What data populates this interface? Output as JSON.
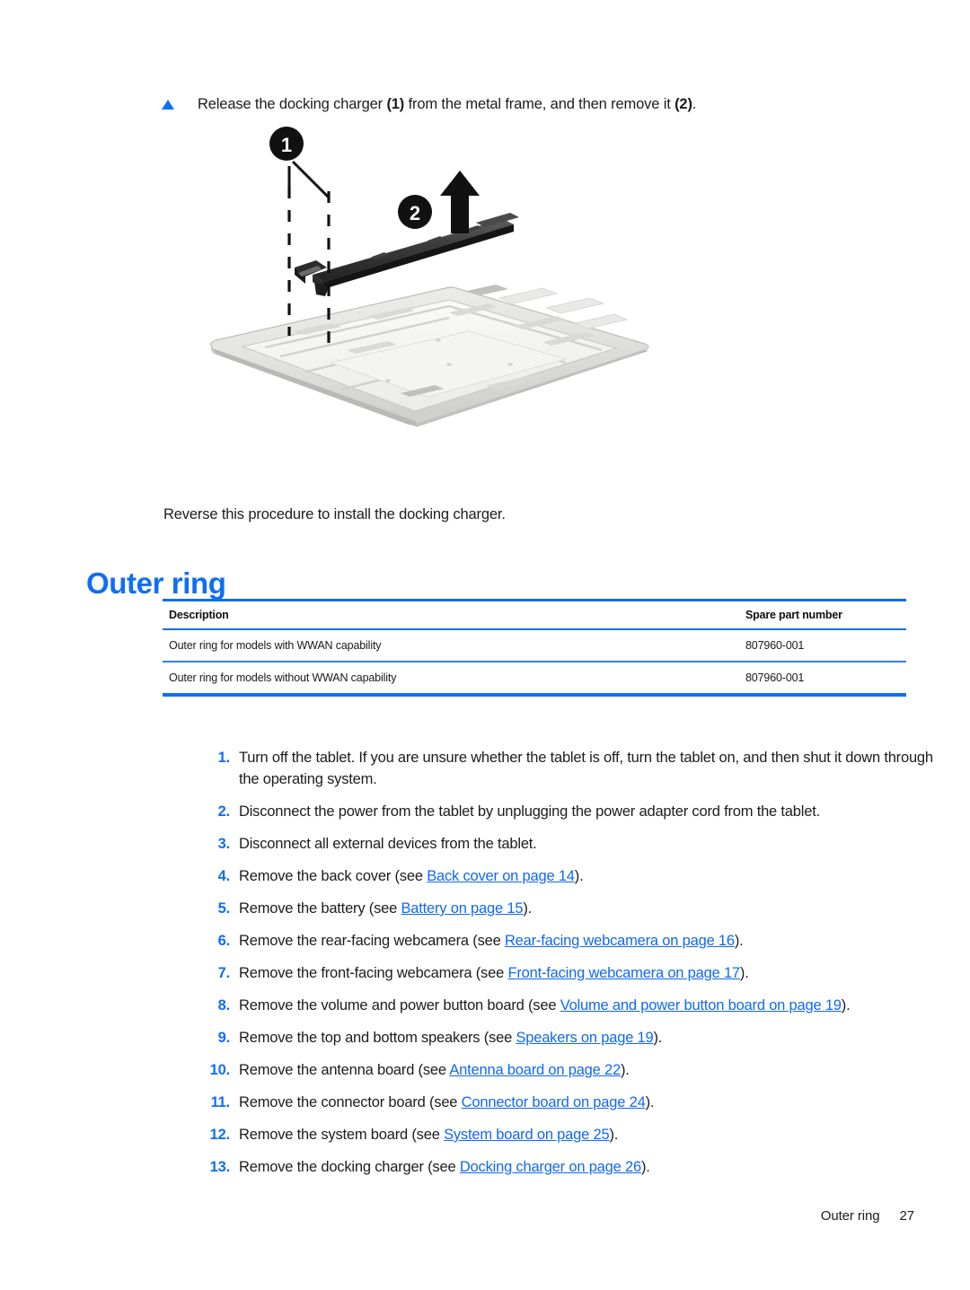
{
  "document": {
    "intro_step": {
      "bullet_icon": "triangle-bullet-icon",
      "text_before": "Release the docking charger ",
      "callout_1": "(1)",
      "text_middle": " from the metal frame, and then remove it ",
      "callout_2": "(2)",
      "text_after": "."
    },
    "figure": {
      "alt": "Exploded view of docking charger removal from tablet metal frame",
      "callouts": [
        {
          "label": "1",
          "meaning": "release-points"
        },
        {
          "label": "2",
          "meaning": "lift-out-direction"
        }
      ]
    },
    "reverse_note": "Reverse this procedure to install the docking charger.",
    "section_heading": "Outer ring",
    "table": {
      "headers": [
        "Description",
        "Spare part number"
      ],
      "rows": [
        [
          "Outer ring for models with WWAN capability",
          "807960-001"
        ],
        [
          "Outer ring for models without WWAN capability",
          "807960-001"
        ]
      ]
    },
    "procedure": [
      {
        "number": "1.",
        "prefix": "Turn off the tablet. If you are unsure whether the tablet is off, turn the tablet on, and then shut it down through the operating system.",
        "link": "",
        "suffix": ""
      },
      {
        "number": "2.",
        "prefix": "Disconnect the power from the tablet by unplugging the power adapter cord from the tablet.",
        "link": "",
        "suffix": ""
      },
      {
        "number": "3.",
        "prefix": "Disconnect all external devices from the tablet.",
        "link": "",
        "suffix": ""
      },
      {
        "number": "4.",
        "prefix": "Remove the back cover (see ",
        "link": "Back cover on page 14",
        "suffix": ")."
      },
      {
        "number": "5.",
        "prefix": "Remove the battery (see ",
        "link": "Battery on page 15",
        "suffix": ")."
      },
      {
        "number": "6.",
        "prefix": "Remove the rear-facing webcamera (see ",
        "link": "Rear-facing webcamera on page 16",
        "suffix": ")."
      },
      {
        "number": "7.",
        "prefix": "Remove the front-facing webcamera (see ",
        "link": "Front-facing webcamera on page 17",
        "suffix": ")."
      },
      {
        "number": "8.",
        "prefix": "Remove the volume and power button board (see ",
        "link": "Volume and power button board on page 19",
        "suffix": ")."
      },
      {
        "number": "9.",
        "prefix": "Remove the top and bottom speakers (see ",
        "link": "Speakers on page 19",
        "suffix": ")."
      },
      {
        "number": "10.",
        "prefix": "Remove the antenna board (see ",
        "link": "Antenna board on page 22",
        "suffix": ")."
      },
      {
        "number": "11.",
        "prefix": "Remove the connector board (see ",
        "link": "Connector board on page 24",
        "suffix": ")."
      },
      {
        "number": "12.",
        "prefix": "Remove the system board (see ",
        "link": "System board on page 25",
        "suffix": ")."
      },
      {
        "number": "13.",
        "prefix": "Remove the docking charger (see ",
        "link": "Docking charger on page 26",
        "suffix": ")."
      }
    ],
    "footer": {
      "section": "Outer ring",
      "page_number": "27"
    },
    "colors": {
      "accent_blue": "#0f6ef5",
      "link_blue": "#1168f0",
      "text": "#1c1c1c",
      "rule_blue": "#2f7ef7"
    }
  }
}
